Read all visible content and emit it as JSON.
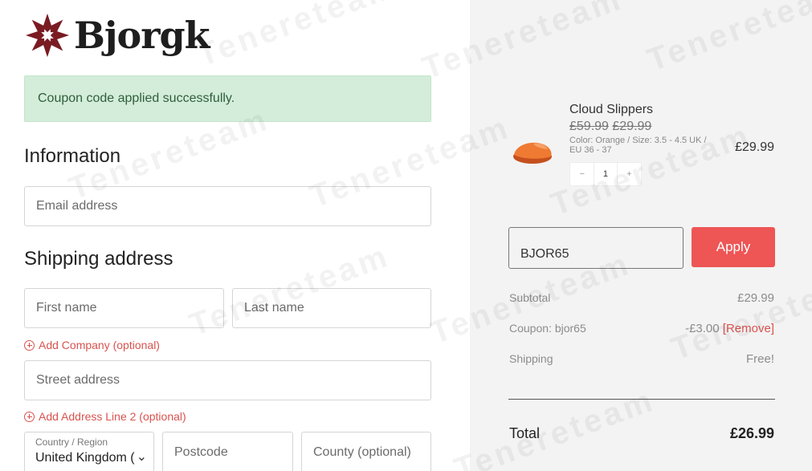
{
  "brand": {
    "name": "Bjorgk"
  },
  "alert": {
    "message": "Coupon code applied successfully."
  },
  "information": {
    "heading": "Information",
    "email_placeholder": "Email address"
  },
  "shipping": {
    "heading": "Shipping address",
    "first_name_placeholder": "First name",
    "last_name_placeholder": "Last name",
    "add_company": "Add Company (optional)",
    "street_placeholder": "Street address",
    "add_line2": "Add Address Line 2 (optional)",
    "country_label": "Country / Region",
    "country_value": "United Kingdom (",
    "postcode_placeholder": "Postcode",
    "county_placeholder": "County (optional)"
  },
  "cart": {
    "product": {
      "name": "Cloud Slippers",
      "old_price": "£59.99",
      "sale_price": "£29.99",
      "meta": "Color: Orange / Size: 3.5 - 4.5 UK / EU 36 - 37",
      "line_price": "£29.99",
      "quantity": "1",
      "minus": "−",
      "plus": "+"
    },
    "coupon_value": "BJOR65",
    "apply_label": "Apply",
    "subtotal_label": "Subtotal",
    "subtotal_value": "£29.99",
    "coupon_label": "Coupon: bjor65",
    "coupon_discount": "-£3.00",
    "remove_label": "[Remove]",
    "shipping_label": "Shipping",
    "shipping_value": "Free!",
    "total_label": "Total",
    "total_value": "£26.99"
  },
  "watermark": {
    "text": "Tenereteam"
  },
  "colors": {
    "accent": "#ee5555",
    "link": "#d9534f",
    "success_bg": "#d4edda",
    "brand_mark": "#7a1b22"
  },
  "icons": [
    "brand-star-icon",
    "plus-circle-icon",
    "chevron-down-icon",
    "slipper-product-image"
  ]
}
